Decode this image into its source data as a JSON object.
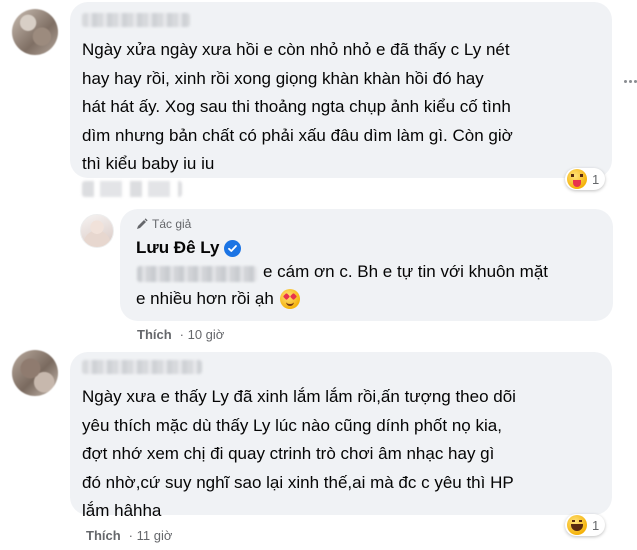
{
  "comments": [
    {
      "text": "Ngày xửa ngày xưa hồi e còn nhỏ nhỏ e đã thấy c Ly nét\nhay hay rồi, xinh rồi xong giọng khàn khàn hồi đó hay\nhát hát ấy. Xog sau thi thoảng ngta chụp ảnh kiểu cố tình\ndìm nhưng bản chất có phải xấu đâu dìm làm gì. Còn giờ\nthì kiểu baby iu iu",
      "reaction_count": "1",
      "reaction_icon": "tongue-emoji-icon"
    },
    {
      "author_badge": "Tác giả",
      "author": "Lưu Đê Ly",
      "text_line1": "e cám ơn c. Bh e tự tin với khuôn mặt",
      "text_line2": "e nhiều hơn rồi ạh",
      "like_label": "Thích",
      "time": "· 10 giờ"
    },
    {
      "text": "Ngày xưa e thấy Ly đã xinh lắm lắm rồi,ấn tượng theo dõi\nyêu thích mặc dù thấy Ly lúc nào cũng dính phốt nọ kia,\nđợt nhớ xem chị đi quay ctrinh trò chơi âm nhạc hay gì\nđó nhờ,cứ suy nghĩ sao lại xinh thế,ai mà đc c yêu thì HP\nlắm hâhha",
      "like_label": "Thích",
      "time": "· 11 giờ",
      "reaction_count": "1",
      "reaction_icon": "haha-emoji-icon"
    }
  ],
  "colors": {
    "bubble": "#f0f2f5",
    "verified": "#1b74e4",
    "meta_text": "#65676b"
  }
}
